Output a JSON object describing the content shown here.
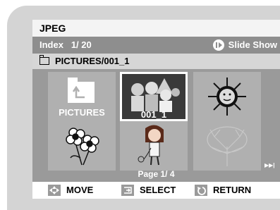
{
  "title": "JPEG",
  "index": {
    "label": "Index",
    "value": "1/ 20"
  },
  "slideshow_label": "Slide Show",
  "path": "PICTURES/001_1",
  "thumbnails": [
    {
      "label": "PICTURES",
      "type": "folder"
    },
    {
      "label": "001_1",
      "type": "image-group",
      "selected": true
    },
    {
      "label": "",
      "type": "image-sun"
    },
    {
      "label": "",
      "type": "image-flowers"
    },
    {
      "label": "",
      "type": "image-girl"
    },
    {
      "label": "",
      "type": "image-tree"
    }
  ],
  "page_indicator": "Page 1/ 4",
  "bottom": {
    "move_label": "MOVE",
    "select_label": "SELECT",
    "return_label": "RETURN"
  },
  "icons": [
    "slideshow-icon",
    "folder-icon",
    "next-page-icon",
    "move-icon",
    "select-icon",
    "return-icon"
  ]
}
